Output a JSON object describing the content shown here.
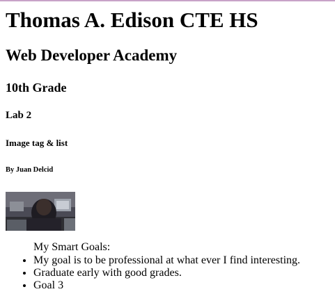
{
  "page": {
    "heading1": "Thomas A. Edison CTE HS",
    "heading2": "Web Developer Academy",
    "heading3": "10th Grade",
    "heading4": "Lab 2",
    "heading5": "Image tag & list",
    "heading6": "By Juan Delcid"
  },
  "image": {
    "description": "classroom-photo"
  },
  "list": {
    "label": "My Smart Goals:",
    "items": [
      "My goal is to be professional at what ever I find interesting.",
      "Graduate early with good grades.",
      "Goal 3"
    ]
  },
  "colors": {
    "background": "#ffffff",
    "text": "#000000",
    "top_rule": "#c8a2c8"
  }
}
